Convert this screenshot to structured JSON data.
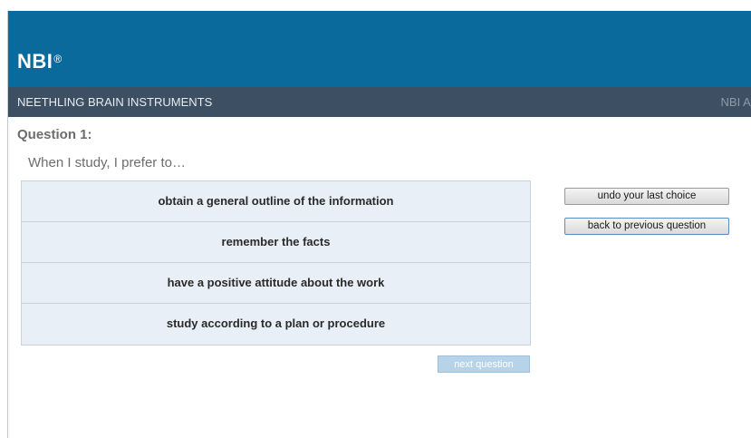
{
  "header": {
    "logo_text": "NBI",
    "logo_mark": "®"
  },
  "navbar": {
    "org_name": "NEETHLING BRAIN INSTRUMENTS",
    "admin_link": "NBI Ad"
  },
  "question": {
    "title": "Question 1:",
    "prompt": "When I study, I prefer to…",
    "answers": [
      "obtain a general outline of the information",
      "remember the facts",
      "have a positive attitude about the work",
      "study according to a plan or procedure"
    ]
  },
  "buttons": {
    "next": "next question",
    "undo": "undo your last choice",
    "back": "back to previous question"
  },
  "colors": {
    "header_bg": "#0b6a9c",
    "navbar_bg": "#3d4f62",
    "answers_bg": "#e9eff6",
    "next_disabled_bg": "#b7d3ea"
  }
}
